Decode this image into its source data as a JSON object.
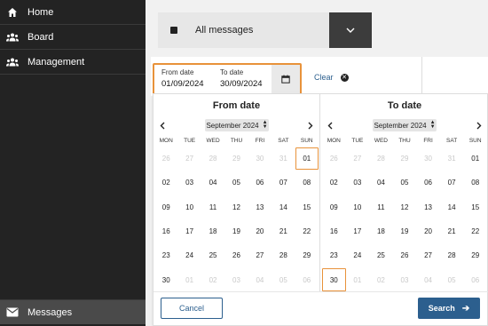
{
  "sidebar": {
    "items": [
      {
        "label": "Home",
        "icon": "home-icon"
      },
      {
        "label": "Board",
        "icon": "users-icon"
      },
      {
        "label": "Management",
        "icon": "users-icon"
      }
    ],
    "active_item": {
      "label": "Messages",
      "icon": "envelope-icon"
    }
  },
  "filter": {
    "message_select_value": "All messages",
    "from_caption": "From date",
    "from_value": "01/09/2024",
    "to_caption": "To date",
    "to_value": "30/09/2024",
    "clear_label": "Clear"
  },
  "colors": {
    "accent": "#e8923a",
    "primary": "#2c5f8e",
    "sidebar_bg": "#232323"
  },
  "calendars": {
    "weekdays": [
      "MON",
      "TUE",
      "WED",
      "THU",
      "FRI",
      "SAT",
      "SUN"
    ],
    "from": {
      "title": "From date",
      "month_label": "September 2024",
      "days": [
        {
          "d": "26",
          "m": true
        },
        {
          "d": "27",
          "m": true
        },
        {
          "d": "28",
          "m": true
        },
        {
          "d": "29",
          "m": true
        },
        {
          "d": "30",
          "m": true
        },
        {
          "d": "31",
          "m": true
        },
        {
          "d": "01",
          "sel": true
        },
        {
          "d": "02"
        },
        {
          "d": "03"
        },
        {
          "d": "04"
        },
        {
          "d": "05"
        },
        {
          "d": "06"
        },
        {
          "d": "07"
        },
        {
          "d": "08"
        },
        {
          "d": "09"
        },
        {
          "d": "10"
        },
        {
          "d": "11"
        },
        {
          "d": "12"
        },
        {
          "d": "13"
        },
        {
          "d": "14"
        },
        {
          "d": "15"
        },
        {
          "d": "16"
        },
        {
          "d": "17"
        },
        {
          "d": "18"
        },
        {
          "d": "19"
        },
        {
          "d": "20"
        },
        {
          "d": "21"
        },
        {
          "d": "22"
        },
        {
          "d": "23"
        },
        {
          "d": "24"
        },
        {
          "d": "25"
        },
        {
          "d": "26"
        },
        {
          "d": "27"
        },
        {
          "d": "28"
        },
        {
          "d": "29"
        },
        {
          "d": "30"
        },
        {
          "d": "01",
          "m": true
        },
        {
          "d": "02",
          "m": true
        },
        {
          "d": "03",
          "m": true
        },
        {
          "d": "04",
          "m": true
        },
        {
          "d": "05",
          "m": true
        },
        {
          "d": "06",
          "m": true
        }
      ]
    },
    "to": {
      "title": "To date",
      "month_label": "September 2024",
      "days": [
        {
          "d": "26",
          "m": true
        },
        {
          "d": "27",
          "m": true
        },
        {
          "d": "28",
          "m": true
        },
        {
          "d": "29",
          "m": true
        },
        {
          "d": "30",
          "m": true
        },
        {
          "d": "31",
          "m": true
        },
        {
          "d": "01"
        },
        {
          "d": "02"
        },
        {
          "d": "03"
        },
        {
          "d": "04"
        },
        {
          "d": "05"
        },
        {
          "d": "06"
        },
        {
          "d": "07"
        },
        {
          "d": "08"
        },
        {
          "d": "09"
        },
        {
          "d": "10"
        },
        {
          "d": "11"
        },
        {
          "d": "12"
        },
        {
          "d": "13"
        },
        {
          "d": "14"
        },
        {
          "d": "15"
        },
        {
          "d": "16"
        },
        {
          "d": "17"
        },
        {
          "d": "18"
        },
        {
          "d": "19"
        },
        {
          "d": "20"
        },
        {
          "d": "21"
        },
        {
          "d": "22"
        },
        {
          "d": "23"
        },
        {
          "d": "24"
        },
        {
          "d": "25"
        },
        {
          "d": "26"
        },
        {
          "d": "27"
        },
        {
          "d": "28"
        },
        {
          "d": "29"
        },
        {
          "d": "30",
          "sel": true
        },
        {
          "d": "01",
          "m": true
        },
        {
          "d": "02",
          "m": true
        },
        {
          "d": "03",
          "m": true
        },
        {
          "d": "04",
          "m": true
        },
        {
          "d": "05",
          "m": true
        },
        {
          "d": "06",
          "m": true
        }
      ]
    }
  },
  "footer": {
    "cancel_label": "Cancel",
    "search_label": "Search"
  }
}
